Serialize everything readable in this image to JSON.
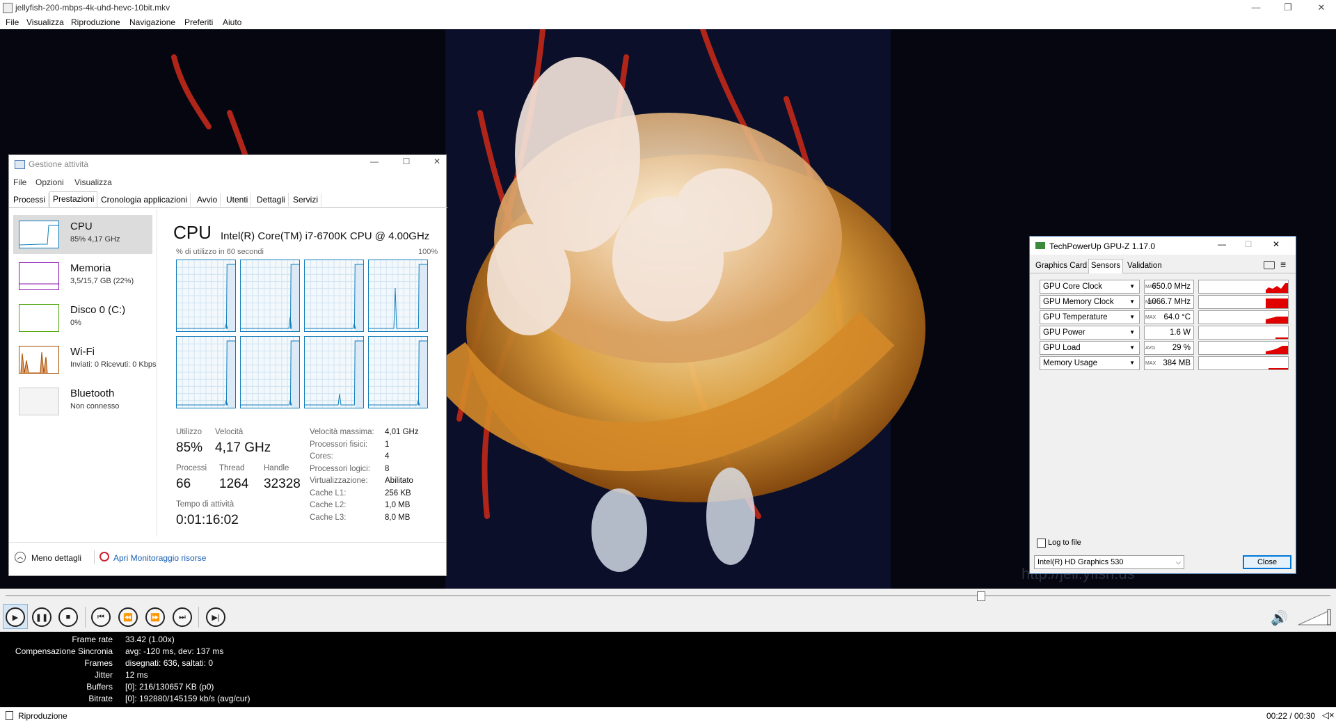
{
  "player": {
    "title": "jellyfish-200-mbps-4k-uhd-hevc-10bit.mkv",
    "menu": [
      "File",
      "Visualizza",
      "Riproduzione",
      "Navigazione",
      "Preferiti",
      "Aiuto"
    ],
    "seek_position": 0.733,
    "stats": [
      {
        "label": "Frame rate",
        "value": "33.42 (1.00x)"
      },
      {
        "label": "Compensazione Sincronia",
        "value": "avg: -120 ms, dev: 137 ms"
      },
      {
        "label": "Frames",
        "value": "disegnati: 636, saltati: 0"
      },
      {
        "label": "Jitter",
        "value": "12 ms"
      },
      {
        "label": "Buffers",
        "value": "[0]: 216/130657 KB (p0)"
      },
      {
        "label": "Bitrate",
        "value": "[0]: 192880/145159 kb/s (avg/cur)"
      }
    ],
    "status": "Riproduzione",
    "time": "00:22 / 00:30",
    "watermark": "http://jell.yfish.us"
  },
  "taskmgr": {
    "title": "Gestione attività",
    "menu": [
      "File",
      "Opzioni",
      "Visualizza"
    ],
    "tabs": [
      "Processi",
      "Prestazioni",
      "Cronologia applicazioni",
      "Avvio",
      "Utenti",
      "Dettagli",
      "Servizi"
    ],
    "side": [
      {
        "title": "CPU",
        "sub": "85% 4,17 GHz",
        "color": "#117dbb"
      },
      {
        "title": "Memoria",
        "sub": "3,5/15,7 GB (22%)",
        "color": "#8b12ae"
      },
      {
        "title": "Disco 0 (C:)",
        "sub": "0%",
        "color": "#4da60c"
      },
      {
        "title": "Wi-Fi",
        "sub": "Inviati: 0 Ricevuti: 0 Kbps",
        "color": "#a74f01"
      },
      {
        "title": "Bluetooth",
        "sub": "Non connesso",
        "color": "#999999"
      }
    ],
    "cpu_heading": "CPU",
    "cpu_model": "Intel(R) Core(TM) i7-6700K CPU @ 4.00GHz",
    "graph_caption": "% di utilizzo in 60 secondi",
    "graph_max": "100%",
    "utilizzo_label": "Utilizzo",
    "utilizzo": "85%",
    "velocita_label": "Velocità",
    "velocita": "4,17 GHz",
    "processi_label": "Processi",
    "processi": "66",
    "thread_label": "Thread",
    "thread": "1264",
    "handle_label": "Handle",
    "handle": "32328",
    "uptime_label": "Tempo di attività",
    "uptime": "0:01:16:02",
    "details": [
      {
        "label": "Velocità massima:",
        "value": "4,01 GHz"
      },
      {
        "label": "Processori fisici:",
        "value": "1"
      },
      {
        "label": "Cores:",
        "value": "4"
      },
      {
        "label": "Processori logici:",
        "value": "8"
      },
      {
        "label": "Virtualizzazione:",
        "value": "Abilitato"
      },
      {
        "label": "Cache L1:",
        "value": "256 KB"
      },
      {
        "label": "Cache L2:",
        "value": "1,0 MB"
      },
      {
        "label": "Cache L3:",
        "value": "8,0 MB"
      }
    ],
    "less_details": "Meno dettagli",
    "resource_monitor": "Apri Monitoraggio risorse"
  },
  "gpuz": {
    "title": "TechPowerUp GPU-Z 1.17.0",
    "tabs": [
      "Graphics Card",
      "Sensors",
      "Validation"
    ],
    "sensors": [
      {
        "name": "GPU Core Clock",
        "tag": "MAX",
        "value": "650.0 MHz"
      },
      {
        "name": "GPU Memory Clock",
        "tag": "MAX",
        "value": "1066.7 MHz"
      },
      {
        "name": "GPU Temperature",
        "tag": "MAX",
        "value": "64.0 °C"
      },
      {
        "name": "GPU Power",
        "tag": "",
        "value": "1.6 W"
      },
      {
        "name": "GPU Load",
        "tag": "AVG",
        "value": "29 %"
      },
      {
        "name": "Memory Usage",
        "tag": "MAX",
        "value": "384 MB"
      }
    ],
    "log_label": "Log to file",
    "adapter": "Intel(R) HD Graphics 530",
    "close": "Close"
  }
}
